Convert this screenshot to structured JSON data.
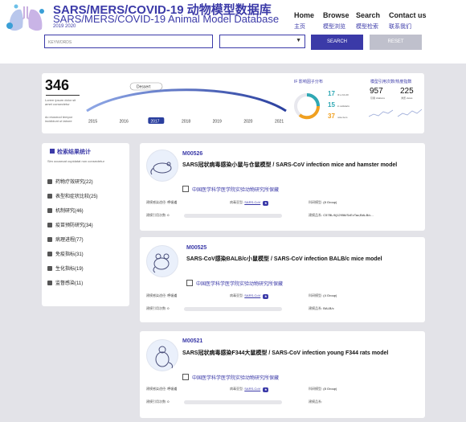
{
  "header": {
    "title_line1": "SARS/MERS/COVID-19 动物模型数据库",
    "title_line2": "SARS/MERS/COVID-19 Animal Model Database",
    "years": "2019 2020",
    "nav": [
      {
        "en": "Home",
        "zh": "主页"
      },
      {
        "en": "Browse",
        "zh": "模型浏览"
      },
      {
        "en": "Search",
        "zh": "模型检索"
      },
      {
        "en": "Contact us",
        "zh": "联系我们"
      }
    ]
  },
  "search": {
    "placeholder": "KEYWORDS",
    "search_label": "SEARCH",
    "reset_label": "RESET"
  },
  "stats": {
    "total": "346",
    "text_a": "Lorem ipsum dolor sit amet consectetur",
    "text_b": "do eiusmod tempor incididunt ut labore",
    "timeline_tag": "Dessert",
    "years": [
      "2015",
      "2016",
      "2017",
      "2018",
      "2019",
      "2020",
      "2021"
    ],
    "active_year": "2017",
    "if_title": "IF 影响因子分布",
    "if_values": [
      {
        "num": "17",
        "label": "IF ≥ 10-20"
      },
      {
        "num": "15",
        "label": "in cellularis"
      },
      {
        "num": "37",
        "label": "note item"
      }
    ],
    "cite_title": "模型引用次数/热度指数",
    "cite_values": [
      {
        "num": "957",
        "label": "引用 citations"
      },
      {
        "num": "225",
        "label": "浏览 views"
      }
    ],
    "colors": {
      "accent": "#3b3aa8",
      "teal": "#2fa8b4",
      "orange": "#f0a020"
    }
  },
  "sidebar": {
    "title": "检索结果统计",
    "subtitle": "Sim occaecat cupidatat non consectetur",
    "items": [
      {
        "icon": "medicine-icon",
        "label": "药物疗效研究(22)"
      },
      {
        "icon": "phenotype-icon",
        "label": "表型和症状比较(25)"
      },
      {
        "icon": "mechanism-icon",
        "label": "机制研究(46)"
      },
      {
        "icon": "vaccine-icon",
        "label": "疫苗预防研究(34)"
      },
      {
        "icon": "pathology-icon",
        "label": "病理进程(77)"
      },
      {
        "icon": "immune-icon",
        "label": "免疫指标(31)"
      },
      {
        "icon": "biochem-icon",
        "label": "生化指标(19)"
      },
      {
        "icon": "monitor-icon",
        "label": "监督感染(11)"
      }
    ]
  },
  "cards": [
    {
      "id": "M00526",
      "title": "SARS冠状病毒感染小鼠与仓鼠模型 / SARS-CoV infection mice and hamster model",
      "org": "中国医学科学医学院实验动物研究所保藏",
      "route_label": "建模感染途径:",
      "route": "呼吸道",
      "pathogen_label": "病毒亚型:",
      "pathogen": "SARS-CoV",
      "species_label": "科研模型:",
      "species": "(8 Group)",
      "cite_label": "建模引用次数:",
      "cite": "0",
      "strain_label": "建模品系:",
      "strain": "C57BL/6(12956/SvEvTac;BALB/c..."
    },
    {
      "id": "M00525",
      "title": "SARS-CoV感染BALB/c小鼠模型 / SARS-CoV infection BALB/c mice model",
      "org": "中国医学科学医学院实验动物研究所保藏",
      "route_label": "建模感染途径:",
      "route": "呼吸道",
      "pathogen_label": "病毒亚型:",
      "pathogen": "SARS-CoV",
      "species_label": "科研模型:",
      "species": "(4 Group)",
      "cite_label": "建模引用次数:",
      "cite": "0",
      "strain_label": "建模品系:",
      "strain": "BALB/c"
    },
    {
      "id": "M00521",
      "title": "SARS冠状病毒感染F344大鼠模型 / SARS-CoV infection young F344 rats model",
      "org": "中国医学科学医学院实验动物研究所保藏",
      "route_label": "建模感染途径:",
      "route": "呼吸道",
      "pathogen_label": "病毒亚型:",
      "pathogen": "SARS-CoV",
      "species_label": "科研模型:",
      "species": "(8 Group)",
      "cite_label": "建模引用次数:",
      "cite": "0",
      "strain_label": "建模品系:",
      "strain": ""
    }
  ]
}
